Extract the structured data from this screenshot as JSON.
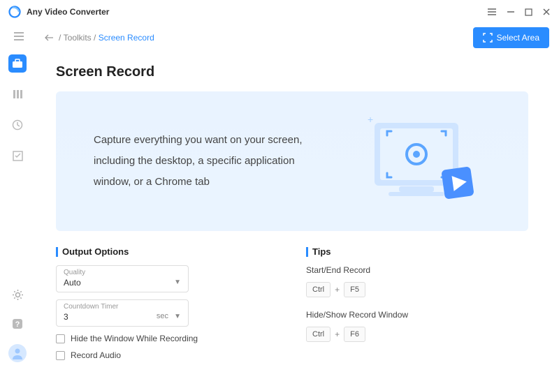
{
  "app": {
    "title": "Any Video Converter"
  },
  "breadcrumb": {
    "root": "Toolkits",
    "current": "Screen Record"
  },
  "header": {
    "select_area": "Select Area"
  },
  "page": {
    "title": "Screen Record",
    "hero": "Capture everything you want on your screen, including the desktop, a specific application window, or a Chrome tab"
  },
  "output": {
    "heading": "Output Options",
    "quality_label": "Quality",
    "quality_value": "Auto",
    "countdown_label": "Countdown Timer",
    "countdown_value": "3",
    "countdown_unit": "sec",
    "hide_window": "Hide the Window While Recording",
    "record_audio": "Record Audio"
  },
  "tips": {
    "heading": "Tips",
    "start_end": "Start/End Record",
    "start_end_keys": {
      "mod": "Ctrl",
      "key": "F5"
    },
    "hide_show": "Hide/Show Record Window",
    "hide_show_keys": {
      "mod": "Ctrl",
      "key": "F6"
    }
  }
}
